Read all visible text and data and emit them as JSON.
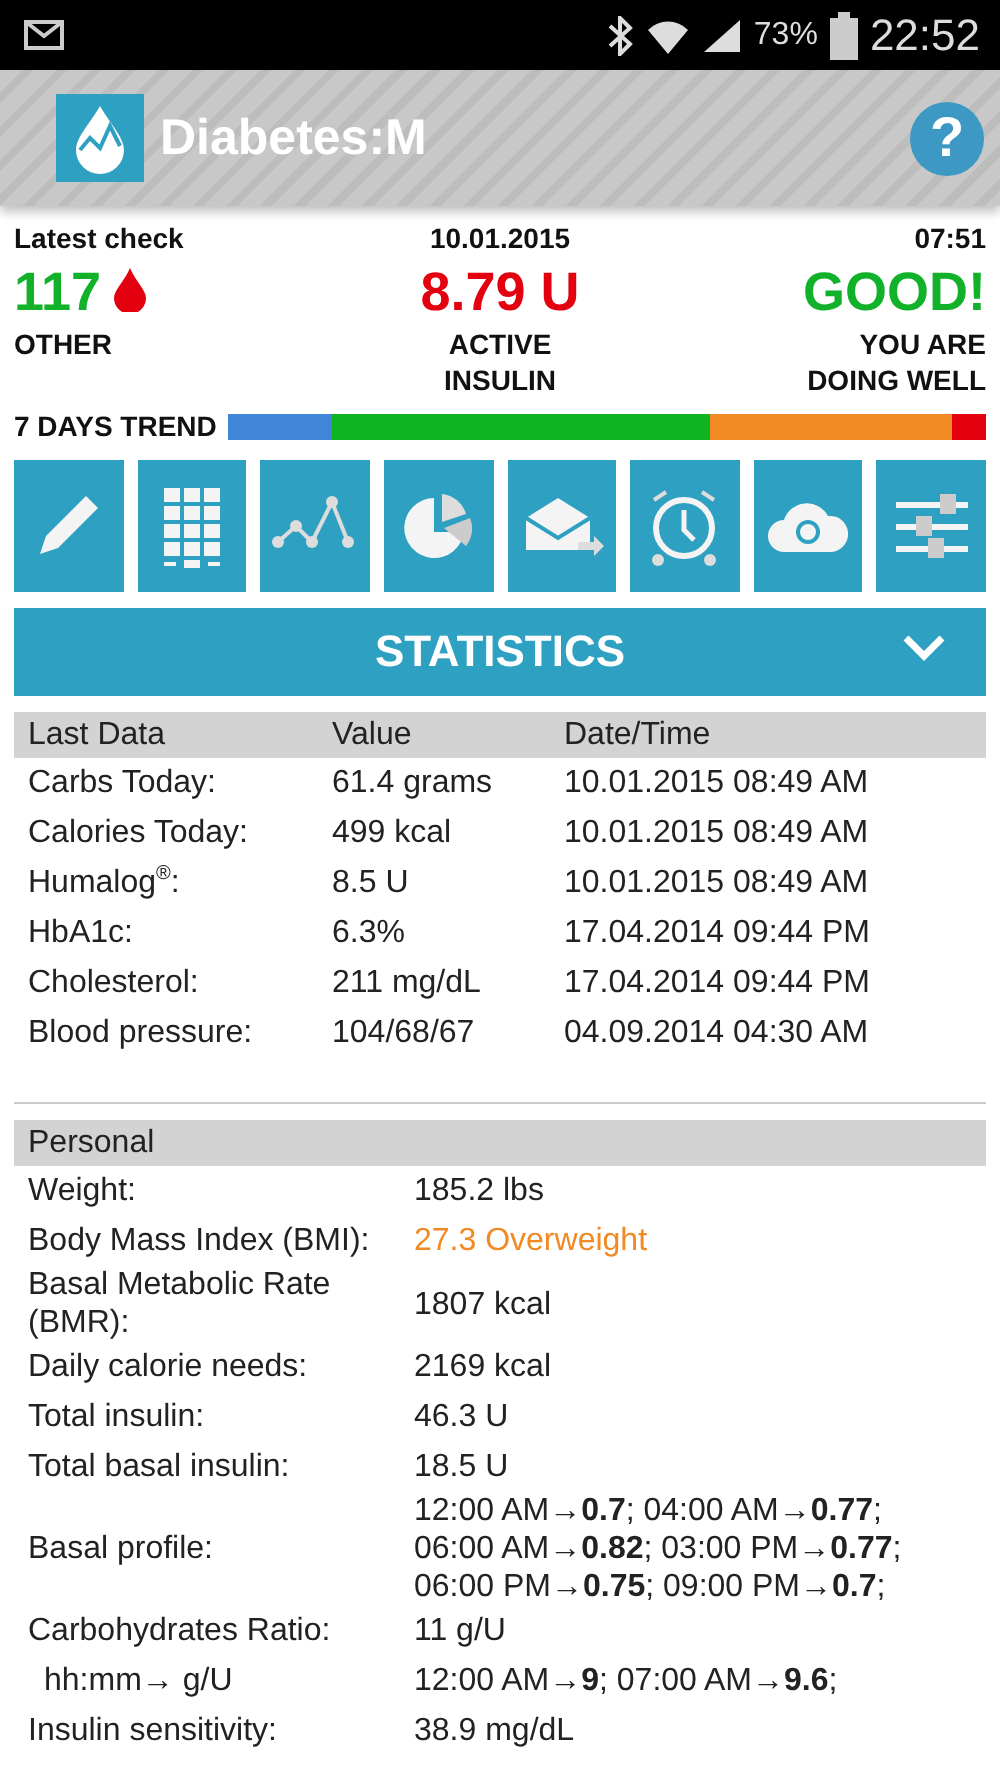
{
  "status_bar": {
    "battery": "73%",
    "time": "22:52"
  },
  "app_bar": {
    "title": "Diabetes:M",
    "help": "?"
  },
  "latest_check": {
    "label": "Latest check",
    "date": "10.01.2015",
    "time": "07:51",
    "summary": [
      {
        "value": "117",
        "caption": "OTHER",
        "color": "#12b12a",
        "kind": "glucose"
      },
      {
        "value": "8.79 U",
        "caption": "ACTIVE INSULIN",
        "color": "#e3000f",
        "kind": "insulin"
      },
      {
        "value": "GOOD!",
        "caption": "YOU ARE DOING WELL",
        "color": "#12b12a",
        "kind": "status"
      }
    ]
  },
  "trend": {
    "label": "7 DAYS TREND",
    "segments": [
      {
        "color": "#3f86d8"
      },
      {
        "color": "#0fb423"
      },
      {
        "color": "#f18a23"
      },
      {
        "color": "#e3000f"
      }
    ]
  },
  "section": {
    "title": "STATISTICS"
  },
  "last_data": {
    "columns": [
      "Last Data",
      "Value",
      "Date/Time"
    ],
    "rows": [
      [
        "Carbs Today:",
        "61.4 grams",
        "10.01.2015 08:49 AM"
      ],
      [
        "Calories Today:",
        "499 kcal",
        "10.01.2015 08:49 AM"
      ],
      [
        "Humalog$^{®}$:",
        "8.5 U",
        "10.01.2015 08:49 AM"
      ],
      [
        "HbA1c:",
        "6.3%",
        "17.04.2014 09:44 PM"
      ],
      [
        "Cholesterol:",
        "211 mg/dL",
        "17.04.2014 09:44 PM"
      ],
      [
        "Blood pressure:",
        "104/68/67",
        "04.09.2014 04:30 AM"
      ]
    ]
  },
  "personal": {
    "title": "Personal",
    "rows": [
      {
        "label": "Weight:",
        "value": [
          "185.2 lbs"
        ]
      },
      {
        "label": "Body Mass Index (BMI):",
        "value": [
          "27.3 Overweight"
        ],
        "color": "#f18a23"
      },
      {
        "label": "Basal Metabolic Rate (BMR):",
        "value": [
          "1807 kcal"
        ]
      },
      {
        "label": "Daily calorie needs:",
        "value": [
          "2169 kcal"
        ]
      },
      {
        "label": "Total insulin:",
        "value": [
          "46.3 U"
        ]
      },
      {
        "label": "Total basal insulin:",
        "value": [
          "18.5 U"
        ]
      },
      {
        "label": "Basal profile:",
        "value": [
          "12:00 AM→**0.7**; 04:00 AM→**0.77**;",
          "06:00 AM→**0.82**; 03:00 PM→**0.77**;",
          "06:00 PM→**0.75**; 09:00 PM→**0.7**;"
        ]
      },
      {
        "label": "Carbohydrates Ratio:",
        "value": [
          "11 g/U"
        ]
      },
      {
        "label": "hh:mm→ g/U",
        "value": [
          "12:00 AM→**9**; 07:00 AM→**9.6**;"
        ],
        "indent": true
      },
      {
        "label": "Insulin sensitivity:",
        "value": [
          "38.9 mg/dL"
        ]
      }
    ]
  }
}
